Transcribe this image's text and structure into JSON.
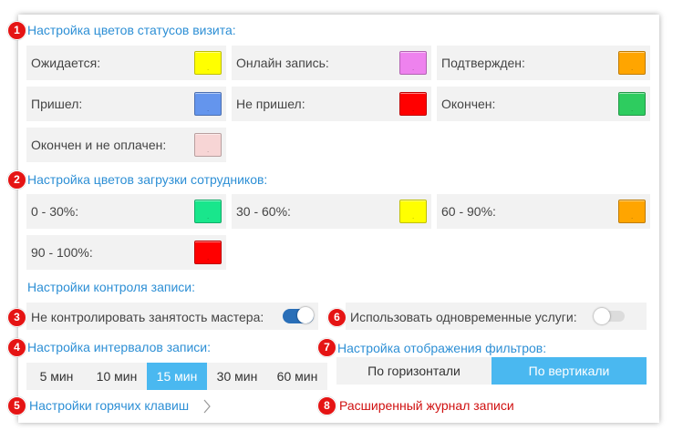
{
  "sections": {
    "status_colors": {
      "badge": "1",
      "title": "Настройка цветов статусов визита:",
      "items": [
        {
          "label": "Ожидается:",
          "color": "#ffff00"
        },
        {
          "label": "Онлайн запись:",
          "color": "#ee82ee"
        },
        {
          "label": "Подтвержден:",
          "color": "#ffa500"
        },
        {
          "label": "Пришел:",
          "color": "#6495ed"
        },
        {
          "label": "Не пришел:",
          "color": "#ff0000"
        },
        {
          "label": "Окончен:",
          "color": "#2ecc5f"
        },
        {
          "label": "Окончен и не оплачен:",
          "color": "#f7d5d5"
        }
      ]
    },
    "load_colors": {
      "badge": "2",
      "title": "Настройка цветов загрузки сотрудников:",
      "items": [
        {
          "label": "0 - 30%:",
          "color": "#19e68c"
        },
        {
          "label": "30 - 60%:",
          "color": "#ffff00"
        },
        {
          "label": "60 - 90%:",
          "color": "#ffa500"
        },
        {
          "label": "90 - 100%:",
          "color": "#ff0000"
        }
      ]
    },
    "record_control": {
      "title": "Настройки контроля записи:",
      "toggles": [
        {
          "badge": "3",
          "label": "Не контролировать занятость мастера:",
          "on": true
        },
        {
          "badge": "6",
          "label": "Использовать одновременные услуги:",
          "on": false
        }
      ]
    },
    "intervals": {
      "badge": "4",
      "title": "Настройка интервалов записи:",
      "options": [
        "5 мин",
        "10 мин",
        "15 мин",
        "30 мин",
        "60 мин"
      ],
      "selected": "15 мин"
    },
    "filter_display": {
      "badge": "7",
      "title": "Настройка отображения фильтров:",
      "options": [
        "По горизонтали",
        "По вертикали"
      ],
      "selected": "По вертикали"
    },
    "hotkeys": {
      "badge": "5",
      "label": "Настройки горячих клавиш"
    },
    "extended_journal": {
      "badge": "8",
      "label": "Расширенный журнал записи"
    }
  },
  "colors": {
    "accent": "#2d8fd5",
    "selected_segment": "#4ab8f0",
    "toggle_on": "#2a6fb8",
    "badge": "#e51414",
    "link_red": "#d01010"
  }
}
